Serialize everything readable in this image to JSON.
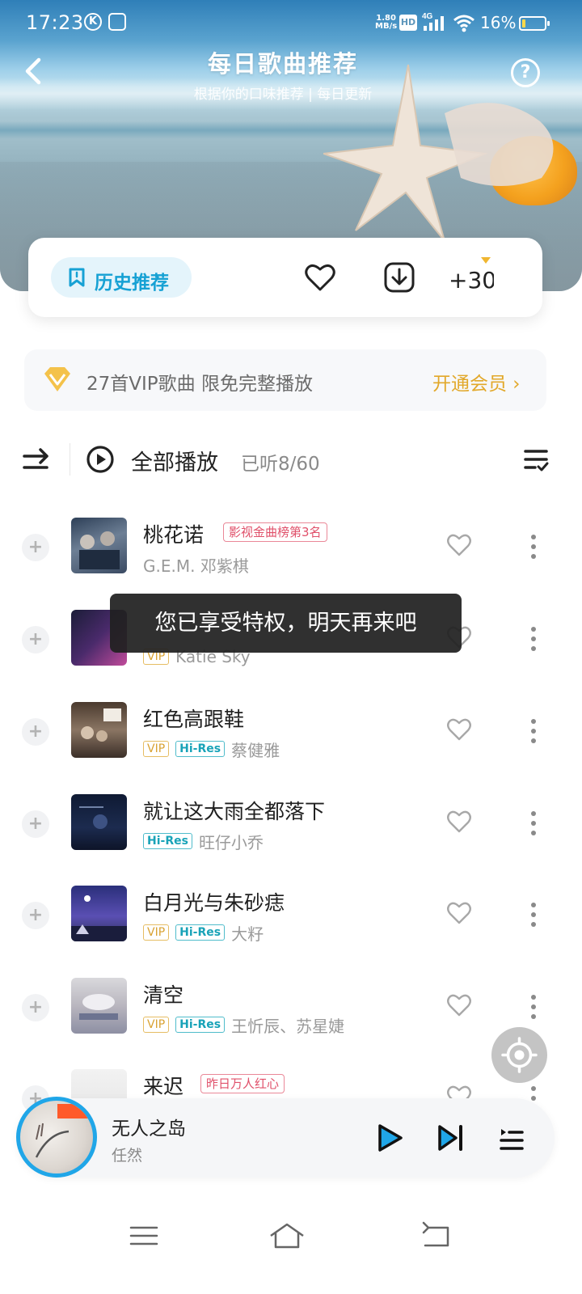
{
  "status_bar": {
    "time": "17:23",
    "net_speed_value": "1.80",
    "net_speed_unit": "MB/s",
    "hd": "HD",
    "signal": "4G",
    "battery_pct": "16%",
    "battery_level": 0.16
  },
  "header": {
    "title": "每日歌曲推荐",
    "subtitle": "根据你的口味推荐 | 每日更新",
    "help": "?"
  },
  "action_card": {
    "history_label": "历史推荐",
    "plus30_label": "+30"
  },
  "vip_banner": {
    "text": "27首VIP歌曲 限免完整播放",
    "open_label": "开通会员 ›"
  },
  "controls": {
    "play_all_label": "全部播放",
    "listened": "已听8/60"
  },
  "songs": [
    {
      "title": "桃花诺",
      "title_tag": "影视金曲榜第3名",
      "artist": "G.E.M. 邓紫棋",
      "vip": false,
      "hires": false
    },
    {
      "title": "",
      "title_tag": "",
      "artist": "Katie Sky",
      "vip": true,
      "hires": false
    },
    {
      "title": "红色高跟鞋",
      "title_tag": "",
      "artist": "蔡健雅",
      "vip": true,
      "hires": true
    },
    {
      "title": "就让这大雨全都落下",
      "title_tag": "",
      "artist": "旺仔小乔",
      "vip": false,
      "hires": true
    },
    {
      "title": "白月光与朱砂痣",
      "title_tag": "",
      "artist": "大籽",
      "vip": true,
      "hires": true
    },
    {
      "title": "清空",
      "title_tag": "",
      "artist": "王忻辰、苏星婕",
      "vip": true,
      "hires": true
    },
    {
      "title": "来迟",
      "title_tag": "昨日万人红心",
      "artist": "",
      "vip": false,
      "hires": false
    }
  ],
  "tags": {
    "vip": "VIP",
    "hires": "Hi-Res"
  },
  "toast": {
    "text": "您已享受特权，明天再来吧"
  },
  "mini_player": {
    "title": "无人之岛",
    "artist": "任然"
  },
  "colors": {
    "accent_blue": "#16a1d4",
    "vip_gold": "#e2a82a",
    "hires_teal": "#19a3b8",
    "rank_red": "#e0506a"
  },
  "icons": {
    "back": "chevron-left-icon",
    "help": "help-circle-icon",
    "history": "bookmark-icon",
    "like": "heart-icon",
    "download": "download-icon",
    "shuffle": "shuffle-icon",
    "play": "play-circle-icon",
    "sort": "sort-list-icon",
    "more": "more-vertical-icon"
  }
}
